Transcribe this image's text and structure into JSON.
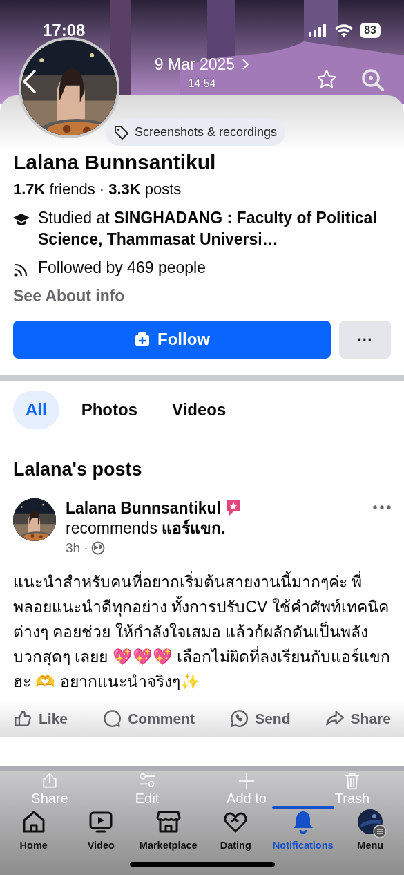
{
  "status_bar": {
    "time": "17:08",
    "battery": "83"
  },
  "photo_viewer": {
    "date": "9 Mar 2025",
    "time": "14:54",
    "album_tag": "Screenshots & recordings",
    "toolbar": [
      {
        "label": "Share",
        "kind": "share"
      },
      {
        "label": "Edit",
        "kind": "edit"
      },
      {
        "label": "Add to",
        "kind": "add"
      },
      {
        "label": "Trash",
        "kind": "trash"
      }
    ]
  },
  "profile": {
    "name": "Lalana Bunnsantikul",
    "stats": "**1.7K** friends · **3.3K** posts",
    "details": [
      {
        "kind": "education",
        "text": "Studied at **SINGHADANG : Faculty of Political Science, Thammasat Universi…**"
      },
      {
        "kind": "followers",
        "text": "Followed by 469 people"
      }
    ],
    "about_link": "See About info",
    "follow_button": "Follow",
    "more_button": "···"
  },
  "filters": [
    {
      "label": "All",
      "selected": true
    },
    {
      "label": "Photos",
      "selected": false
    },
    {
      "label": "Videos",
      "selected": false
    }
  ],
  "posts_heading": "Lalana's posts",
  "post": {
    "author": "Lalana Bunnsantikul",
    "action": "recommends **แอร์แขก.**",
    "time": "3h ·",
    "body": "แนะนำสำหรับคนที่อยากเริ่มต้นสายงานนี้มากๆค่ะ พี่พลอยแนะนำดีทุกอย่าง ทั้งการปรับCV  ใช้คำศัพท์เทคนิคต่างๆ  คอยช่วย ให้กำลังใจเสมอ แล้วก้ผลักดันเป็นพลังบวกสุดๆ เลยย 💖💖💖   เลือกไม่ผิดที่ลงเรียนกับแอร์แขกฮะ 🫶 อยากแนะนำจริงๆ✨",
    "actions": [
      {
        "label": "Like",
        "kind": "like"
      },
      {
        "label": "Comment",
        "kind": "comment"
      },
      {
        "label": "Send",
        "kind": "send"
      },
      {
        "label": "Share",
        "kind": "share"
      }
    ]
  },
  "tab_bar": [
    {
      "label": "Home",
      "kind": "home",
      "selected": false
    },
    {
      "label": "Video",
      "kind": "video",
      "selected": false
    },
    {
      "label": "Marketplace",
      "kind": "marketplace",
      "selected": false
    },
    {
      "label": "Dating",
      "kind": "dating",
      "selected": false
    },
    {
      "label": "Notifications",
      "kind": "notifications",
      "selected": true
    },
    {
      "label": "Menu",
      "kind": "menu",
      "selected": false
    }
  ]
}
